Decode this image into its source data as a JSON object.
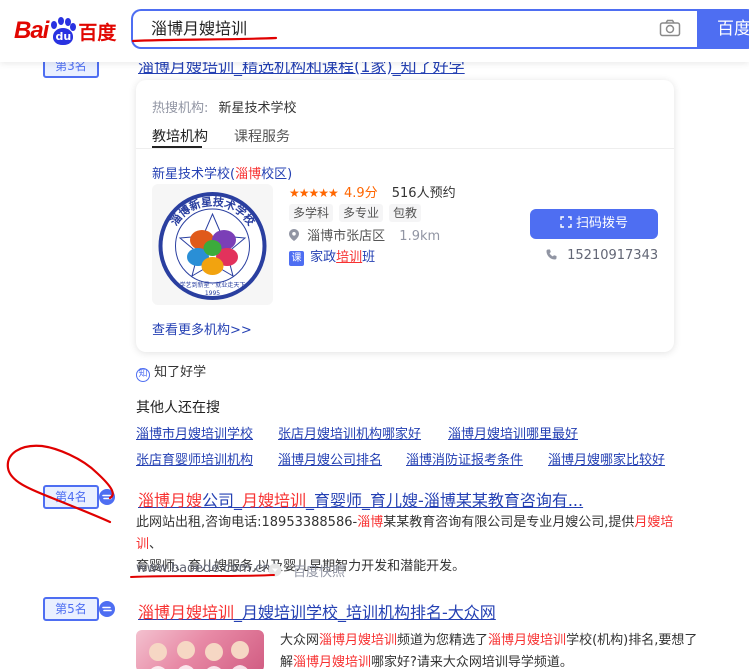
{
  "header": {
    "logo_text": "Bai",
    "logo_paw": "du",
    "logo_cn": "百度",
    "search_value": "淄博月嫂培训",
    "search_button": "百度"
  },
  "results": {
    "r3": {
      "badge": "第3名",
      "title_partial": "淄博月嫂培训_精选机构和课程(1家)_知了好学",
      "card": {
        "hot_label": "热搜机构:",
        "hot_value": "新星技术学校",
        "tabs": [
          "教培机构",
          "课程服务"
        ],
        "school_name_pre": "新星技术学校(",
        "school_name_red": "淄博",
        "school_name_post": "校区)",
        "rating": "4.9分",
        "bookings": "516人预约",
        "tags": [
          "多学科",
          "多专业",
          "包教"
        ],
        "location": "淄博市张店区",
        "distance": "1.9km",
        "course_icon": "课",
        "course_pre": "家政",
        "course_red": "培训",
        "course_post": "班",
        "scan_button": "扫码拨号",
        "phone": "15210917343",
        "more_link": "查看更多机构>>",
        "logo_arc": "淄博新星技术学校",
        "logo_motto": "学艺到新星 · 就业走天下",
        "logo_year": "1995"
      },
      "source_icon": "知",
      "source": "知了好学"
    },
    "related": {
      "title": "其他人还在搜",
      "items": [
        "淄博市月嫂培训学校",
        "张店月嫂培训机构哪家好",
        "淄博月嫂培训哪里最好",
        "张店育婴师培训机构",
        "淄博月嫂公司排名",
        "淄博消防证报考条件",
        "淄博月嫂哪家比较好"
      ]
    },
    "r4": {
      "badge": "第4名",
      "title_a": "淄博月嫂",
      "title_b": "公司_",
      "title_c": "月嫂培训",
      "title_d": "_育婴师_育儿嫂-淄博某某教育咨询有...",
      "snippet_1a": "此网站出租,咨询电话:18953388586-",
      "snippet_1b": "淄博",
      "snippet_1c": "某某教育咨询有限公司是专业月嫂公司,提供",
      "snippet_1d": "月嫂培训",
      "snippet_1e": "、",
      "snippet_2": "育婴师、育儿嫂服务,以及婴儿早期智力开发和潜能开发。",
      "url": "www.baoede.com.cn/",
      "snapshot": "百度快照"
    },
    "r5": {
      "badge": "第5名",
      "title_a": "淄博月嫂培训",
      "title_b": "_月嫂培训学校_培训机构排名-大众网",
      "snippet_1a": "大众网",
      "snippet_1b": "淄博月嫂培训",
      "snippet_1c": "频道为您精选了",
      "snippet_1d": "淄博月嫂培训",
      "snippet_1e": "学校(机构)排名,要想了",
      "snippet_2a": "解",
      "snippet_2b": "淄博月嫂培训",
      "snippet_2c": "哪家好?请来大众网培训导学频道。"
    }
  },
  "colors": {
    "accent": "#4e6ef2",
    "brand_red": "#e10601",
    "link": "#2440b3",
    "highlight": "#f73131",
    "annotation": "#e00000"
  }
}
